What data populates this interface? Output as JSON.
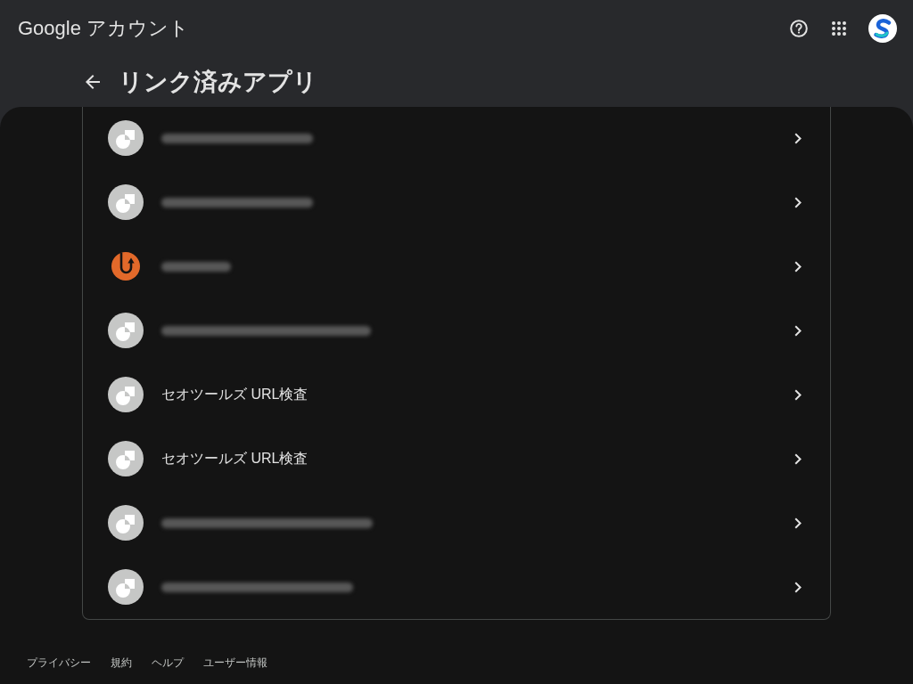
{
  "header": {
    "logo_text": "Google アカウント"
  },
  "page": {
    "title": "リンク済みアプリ"
  },
  "linked_apps": [
    {
      "kind": "generic",
      "blurred": true
    },
    {
      "kind": "generic",
      "blurred": true
    },
    {
      "kind": "circular-arrow",
      "blurred": true
    },
    {
      "kind": "generic",
      "blurred": true
    },
    {
      "kind": "generic",
      "blurred": false,
      "name": "セオツールズ URL検査"
    },
    {
      "kind": "generic",
      "blurred": false,
      "name": "セオツールズ URL検査"
    },
    {
      "kind": "generic",
      "blurred": true
    },
    {
      "kind": "generic",
      "blurred": true
    }
  ],
  "footer": {
    "links": [
      "プライバシー",
      "規約",
      "ヘルプ",
      "ユーザー情報"
    ]
  }
}
